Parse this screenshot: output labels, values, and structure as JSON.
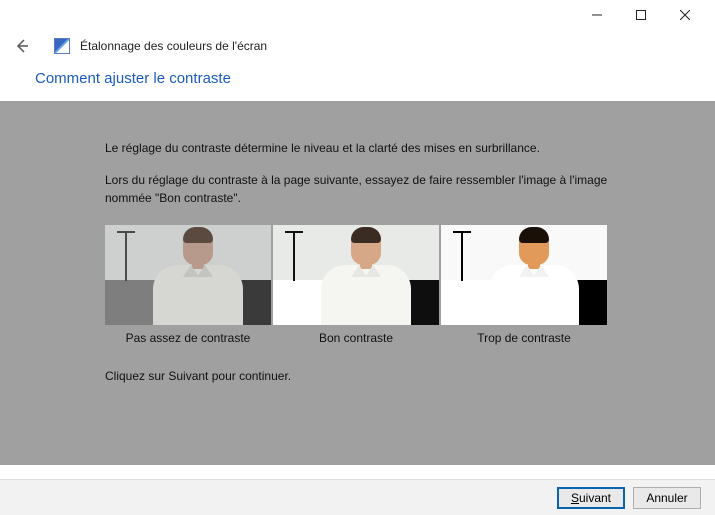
{
  "window": {
    "title": "Étalonnage des couleurs de l'écran"
  },
  "page": {
    "heading": "Comment ajuster le contraste",
    "intro": "Le réglage du contraste détermine le niveau et la clarté des mises en surbrillance.",
    "instruction": "Lors du réglage du contraste à la page suivante, essayez de faire ressembler l'image à l'image nommée \"Bon contraste\".",
    "captions": {
      "low": "Pas assez de contraste",
      "good": "Bon contraste",
      "high": "Trop de contraste"
    },
    "continue_hint": "Cliquez sur Suivant pour continuer."
  },
  "buttons": {
    "next_prefix": "S",
    "next_rest": "uivant",
    "cancel": "Annuler"
  }
}
